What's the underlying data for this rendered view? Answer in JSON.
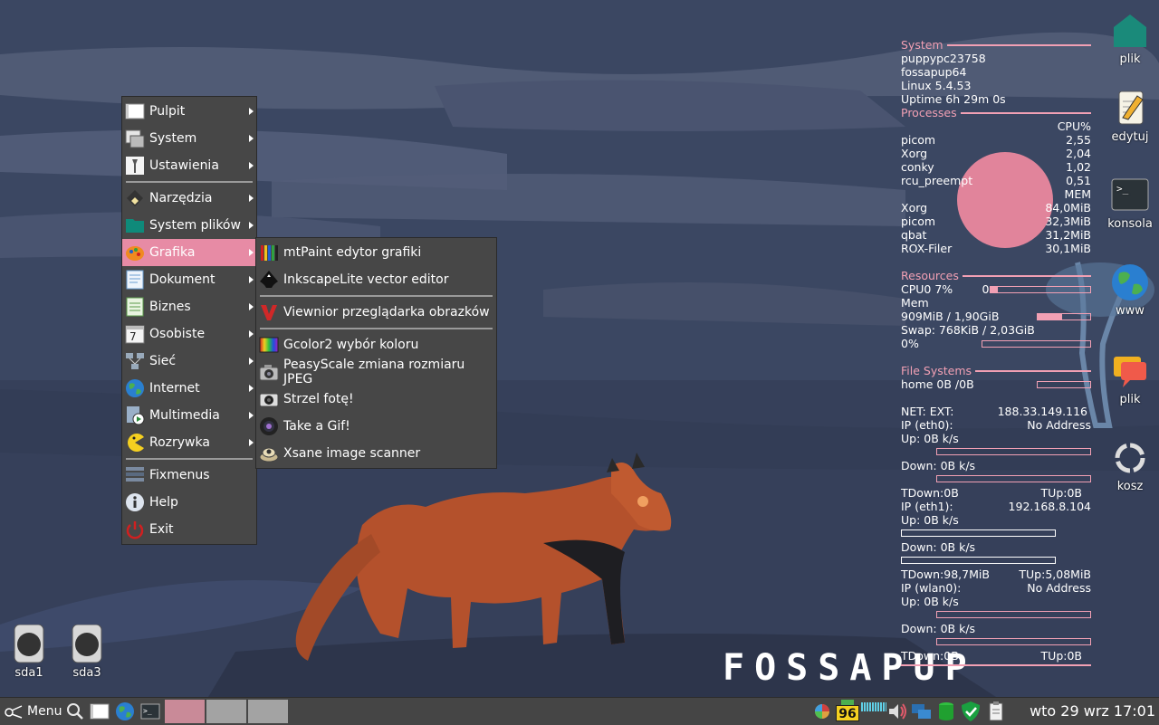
{
  "desktop": {
    "logo_text": "FOSSAPUP",
    "icons_right": [
      {
        "label": "plik",
        "icon": "home-icon"
      },
      {
        "label": "edytuj",
        "icon": "text-editor-icon"
      },
      {
        "label": "konsola",
        "icon": "terminal-icon"
      },
      {
        "label": "www",
        "icon": "globe-icon"
      },
      {
        "label": "plik",
        "icon": "chat-icon"
      },
      {
        "label": "kosz",
        "icon": "trash-icon"
      }
    ],
    "drives": [
      {
        "label": "sda1",
        "icon": "drive-icon"
      },
      {
        "label": "sda3",
        "icon": "drive-icon"
      }
    ]
  },
  "conky": {
    "system_header": "System",
    "hostname": "puppypc23758",
    "distro": "fossapup64",
    "kernel": "Linux 5.4.53",
    "uptime": "Uptime 6h 29m 0s",
    "processes_header": "Processes",
    "cpu_col": "CPU%",
    "cpu_procs": [
      {
        "name": "picom",
        "value": "2,55"
      },
      {
        "name": "Xorg",
        "value": "2,04"
      },
      {
        "name": "conky",
        "value": "1,02"
      },
      {
        "name": "rcu_preempt",
        "value": "0,51"
      }
    ],
    "mem_col": "MEM",
    "mem_procs": [
      {
        "name": "Xorg",
        "value": "84,0MiB"
      },
      {
        "name": "picom",
        "value": "32,3MiB"
      },
      {
        "name": "qbat",
        "value": "31,2MiB"
      },
      {
        "name": "ROX-Filer",
        "value": "30,1MiB"
      }
    ],
    "resources_header": "Resources",
    "cpu0": "CPU0 7%",
    "cpu0_zero": "0",
    "cpu0_fraction": 0.07,
    "mem_label": "Mem",
    "mem_value": "909MiB / 1,90GiB",
    "mem_fraction": 0.47,
    "swap": "Swap: 768KiB / 2,03GiB",
    "swap_pct": "0%",
    "swap_fraction": 0.0,
    "fs_header": "File Systems",
    "fs_home": "home 0B  /0B",
    "net_ext_label": "NET: EXT:",
    "net_ext_ip": "188.33.149.116",
    "eth0_label": "IP (eth0):",
    "eth0_ip": "No Address",
    "eth0_up": " Up: 0B   k/s",
    "eth0_down": " Down: 0B  k/s",
    "eth0_tdown": "TDown:0B",
    "eth0_tup": "TUp:0B",
    "eth1_label": "IP (eth1):",
    "eth1_ip": "192.168.8.104",
    "eth1_up": " Up: 0B   k/s",
    "eth1_down": " Down: 0B  k/s",
    "eth1_tdown": "TDown:98,7MiB",
    "eth1_tup": "TUp:5,08MiB",
    "wlan0_label": "IP (wlan0):",
    "wlan0_ip": "No Address",
    "wlan0_up": " Up: 0B   k/s",
    "wlan0_down": " Down: 0B  k/s",
    "wlan0_tdown": "TDown:0B",
    "wlan0_tup": "TUp:0B"
  },
  "menu": {
    "items": [
      {
        "label": "Pulpit",
        "icon": "desktop-icon"
      },
      {
        "label": "System",
        "icon": "system-icon"
      },
      {
        "label": "Ustawienia",
        "icon": "settings-icon"
      },
      {
        "label": "Narzędzia",
        "icon": "tools-icon"
      },
      {
        "label": "System plików",
        "icon": "folder-icon"
      },
      {
        "label": "Grafika",
        "icon": "palette-icon"
      },
      {
        "label": "Dokument",
        "icon": "document-icon"
      },
      {
        "label": "Biznes",
        "icon": "spreadsheet-icon"
      },
      {
        "label": "Osobiste",
        "icon": "calendar-icon"
      },
      {
        "label": "Sieć",
        "icon": "network-icon"
      },
      {
        "label": "Internet",
        "icon": "globe-icon"
      },
      {
        "label": "Multimedia",
        "icon": "multimedia-icon"
      },
      {
        "label": "Rozrywka",
        "icon": "pacman-icon"
      },
      {
        "label": "Fixmenus",
        "icon": "fixmenus-icon"
      },
      {
        "label": "Help",
        "icon": "info-icon"
      },
      {
        "label": "Exit",
        "icon": "power-icon"
      }
    ],
    "active_item": "Grafika"
  },
  "submenu": {
    "items": [
      {
        "label": "mtPaint edytor grafiki",
        "icon": "pencils-icon"
      },
      {
        "label": "InkscapeLite vector editor",
        "icon": "inkscape-icon"
      },
      {
        "label": "Viewnior przeglądarka obrazków",
        "icon": "viewnior-icon"
      },
      {
        "label": "Gcolor2 wybór koloru",
        "icon": "color-picker-icon"
      },
      {
        "label": "PeasyScale zmiana rozmiaru JPEG",
        "icon": "camera-icon"
      },
      {
        "label": "Strzel fotę!",
        "icon": "screenshot-icon"
      },
      {
        "label": "Take a Gif!",
        "icon": "lens-icon"
      },
      {
        "label": "Xsane image scanner",
        "icon": "scanner-icon"
      }
    ]
  },
  "taskbar": {
    "menu_label": "Menu",
    "battery_value": "96",
    "clock": "wto 29 wrz 17:01",
    "colors": {
      "active_task": "#c98a98",
      "task": "#a3a3a3",
      "accent": "#e78ba5"
    }
  }
}
